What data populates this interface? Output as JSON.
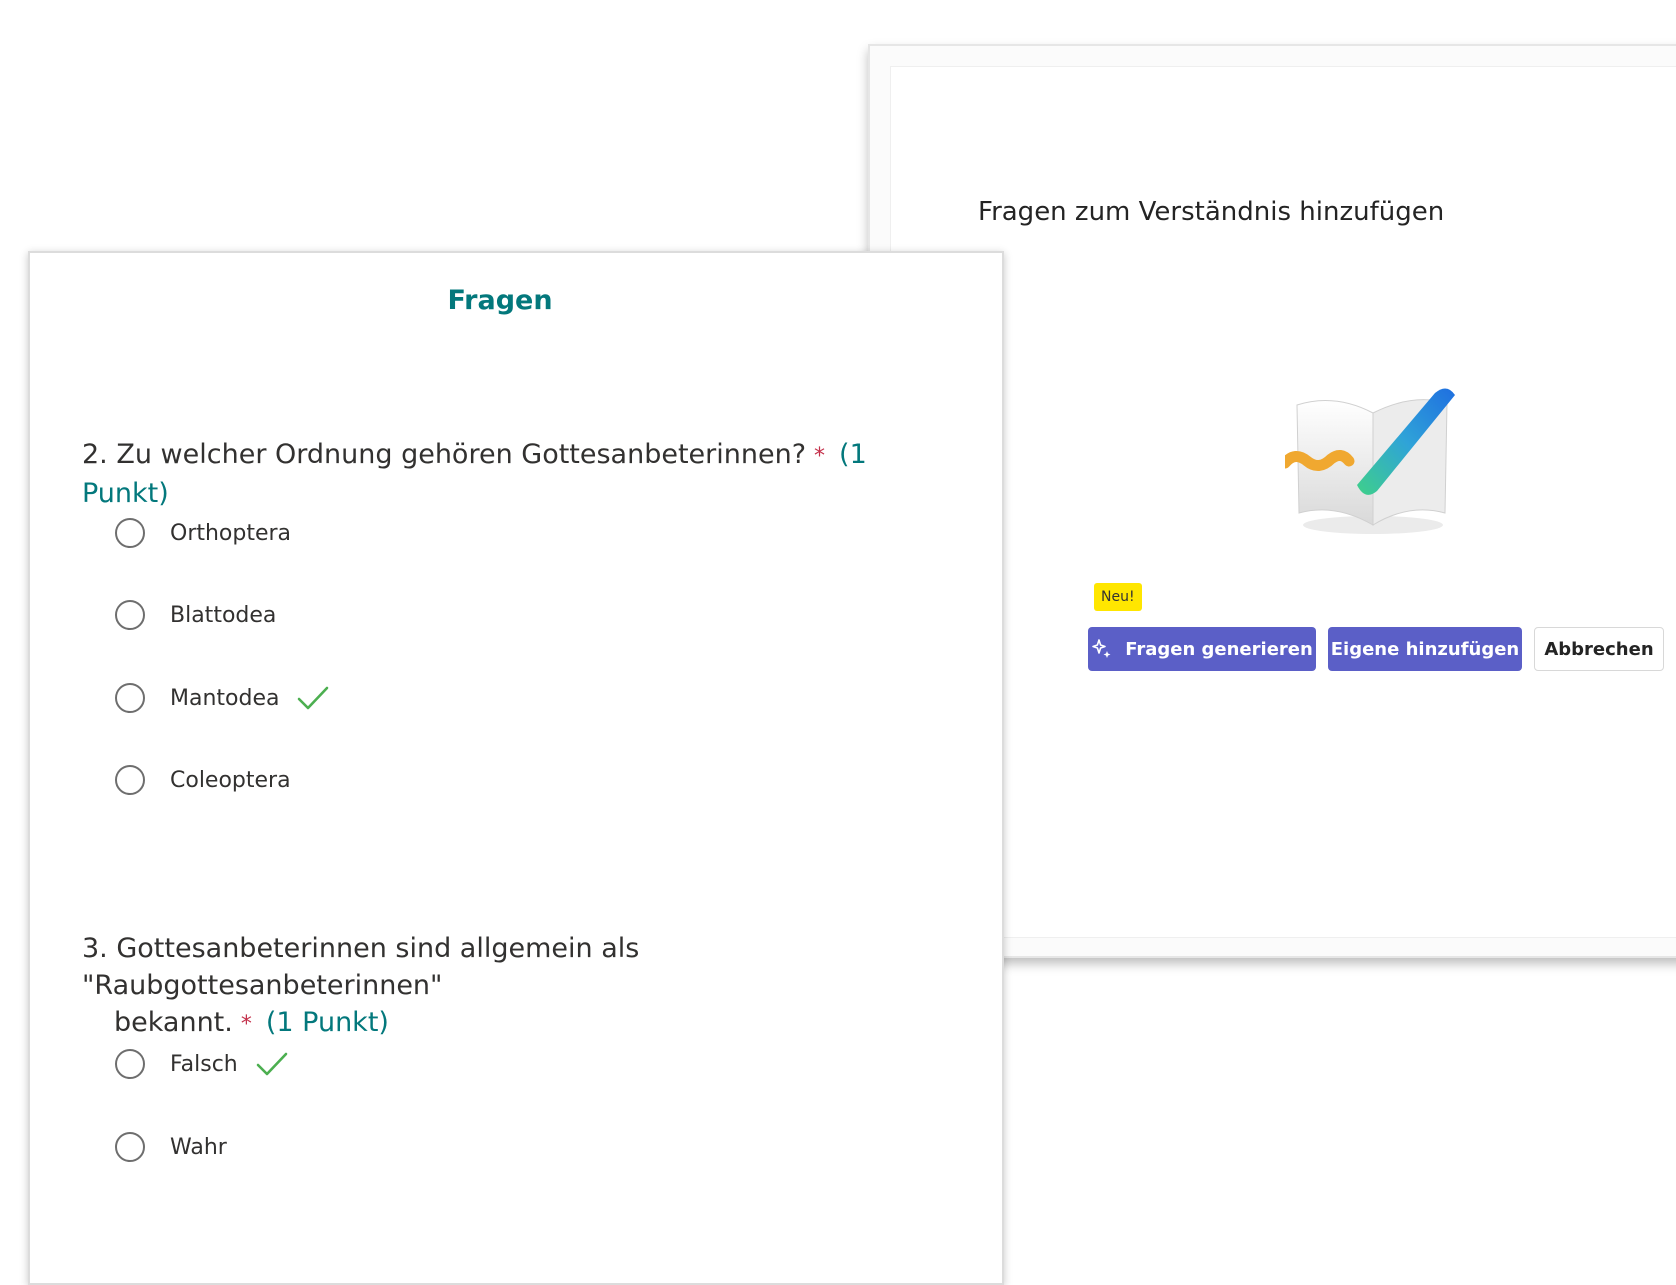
{
  "dialog": {
    "title": "Fragen zum Verständnis hinzufügen",
    "badge": "Neu!",
    "buttons": {
      "generate": "Fragen generieren",
      "own": "Eigene hinzufügen",
      "cancel": "Abbrechen"
    }
  },
  "form": {
    "section_title": "Fragen",
    "questions": [
      {
        "number": "2.",
        "text": "Zu welcher Ordnung gehören Gottesanbeterinnen?",
        "required": "*",
        "points": "(1 Punkt)",
        "options": [
          "Orthoptera",
          "Blattodea",
          "Mantodea",
          "Coleoptera"
        ],
        "correct_option": "Mantodea"
      },
      {
        "number": "3.",
        "text_line1": "Gottesanbeterinnen sind allgemein als \"Raubgottesanbeterinnen\"",
        "text_line2": "bekannt.",
        "required": "*",
        "points": "(1 Punkt)",
        "options": [
          "Falsch",
          "Wahr"
        ],
        "correct_option": "Falsch"
      }
    ]
  },
  "colors": {
    "accent_teal": "#03787c",
    "primary_button": "#5b5fc7",
    "badge_yellow": "#ffe600",
    "required_red": "#c4314b",
    "check_green": "#4caf50"
  },
  "icons": [
    "sparkle-icon",
    "book-pen-illustration",
    "checkmark-icon",
    "radio-button"
  ]
}
